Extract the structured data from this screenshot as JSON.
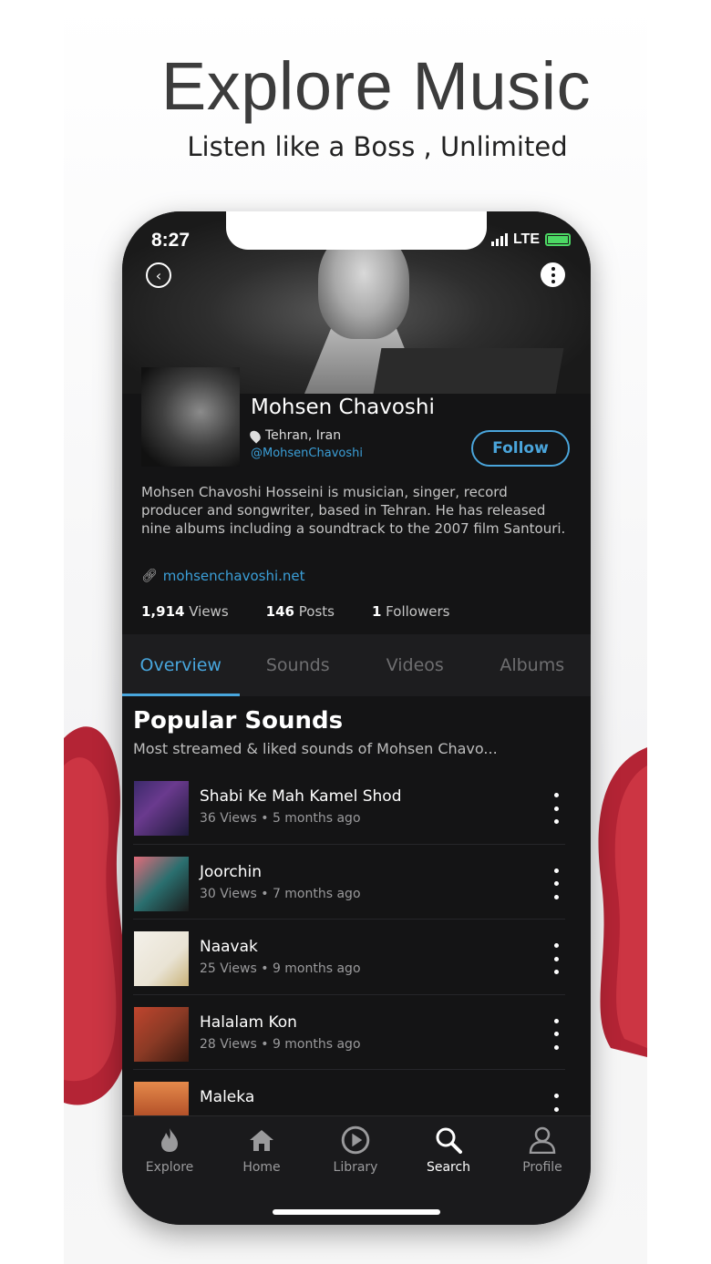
{
  "promo": {
    "headline": "Explore Music",
    "subline": "Listen like a Boss , Unlimited"
  },
  "status_bar": {
    "time": "8:27",
    "network": "LTE"
  },
  "artist": {
    "name": "Mohsen Chavoshi",
    "location": "Tehran, Iran",
    "handle": "@MohsenChavoshi",
    "follow_label": "Follow",
    "bio": "Mohsen Chavoshi Hosseini is musician, singer, record producer and songwriter, based in Tehran. He has released nine albums including a soundtrack to the 2007 film Santouri.",
    "website": "mohsenchavoshi.net",
    "stats": {
      "views_count": "1,914",
      "views_label": "Views",
      "posts_count": "146",
      "posts_label": "Posts",
      "followers_count": "1",
      "followers_label": "Followers"
    }
  },
  "tabs": [
    {
      "label": "Overview",
      "active": true
    },
    {
      "label": "Sounds",
      "active": false
    },
    {
      "label": "Videos",
      "active": false
    },
    {
      "label": "Albums",
      "active": false
    }
  ],
  "popular": {
    "title": "Popular Sounds",
    "subtitle": "Most streamed & liked sounds of Mohsen Chavo..."
  },
  "songs": [
    {
      "title": "Shabi Ke Mah Kamel Shod",
      "meta": "36 Views • 5 months ago"
    },
    {
      "title": "Joorchin",
      "meta": "30 Views • 7 months ago"
    },
    {
      "title": "Naavak",
      "meta": "25 Views • 9 months ago"
    },
    {
      "title": "Halalam Kon",
      "meta": "28 Views • 9 months ago"
    },
    {
      "title": "Maleka",
      "meta": ""
    }
  ],
  "bottom_nav": [
    {
      "label": "Explore",
      "icon": "flame-icon",
      "active": false
    },
    {
      "label": "Home",
      "icon": "house-icon",
      "active": false
    },
    {
      "label": "Library",
      "icon": "play-circle-icon",
      "active": false
    },
    {
      "label": "Search",
      "icon": "search-icon",
      "active": true
    },
    {
      "label": "Profile",
      "icon": "person-icon",
      "active": false
    }
  ],
  "colors": {
    "accent": "#48a6dd",
    "background": "#141415",
    "battery": "#4cd964"
  }
}
